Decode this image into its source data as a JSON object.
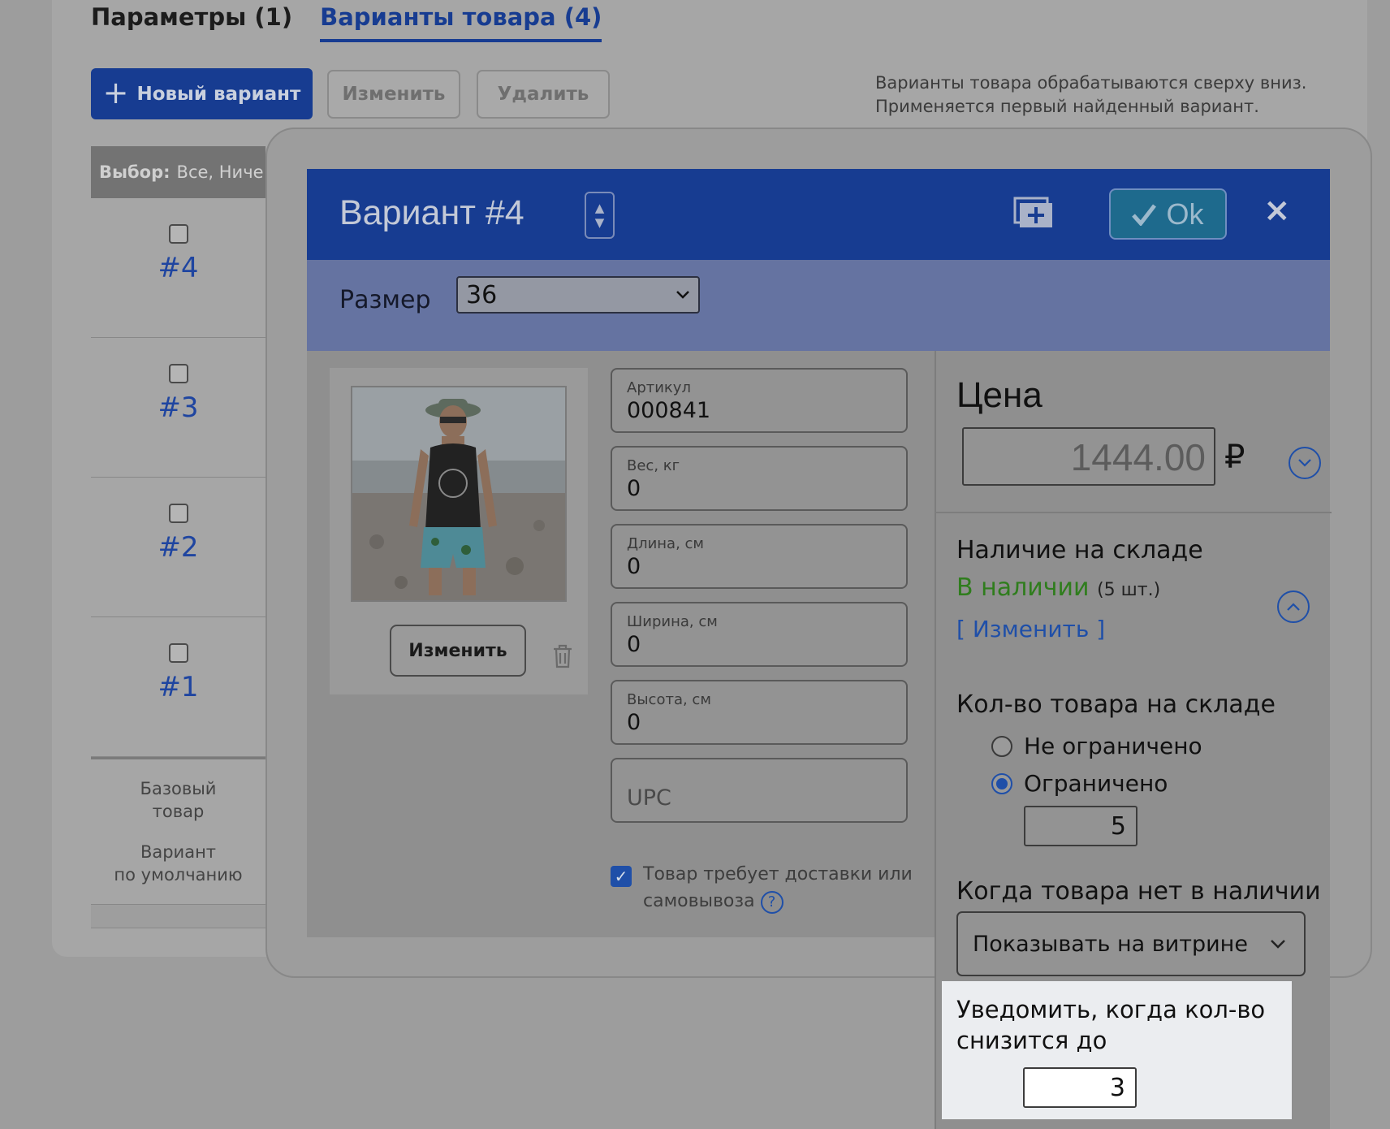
{
  "tabs": [
    {
      "label": "Параметры (1)",
      "active": false
    },
    {
      "label": "Варианты товара (4)",
      "active": true
    }
  ],
  "toolbar": {
    "new_label": "Новый вариант",
    "edit_label": "Изменить",
    "delete_label": "Удалить",
    "hint_line1": "Варианты товара обрабатываются сверху вниз.",
    "hint_line2": "Применяется первый найденный вариант."
  },
  "list": {
    "select_label": "Выбор:",
    "select_options": "Все, Ниче",
    "rows": [
      "#4",
      "#3",
      "#2",
      "#1"
    ],
    "footer_base": [
      "Базовый",
      "товар"
    ],
    "footer_default": [
      "Вариант",
      "по умолчанию"
    ]
  },
  "modal": {
    "title": "Вариант #4",
    "ok_label": "Ok",
    "close_label": "×",
    "size_label": "Размер",
    "size_value": "36",
    "image_change_label": "Изменить",
    "fields": [
      {
        "label": "Артикул",
        "value": "000841"
      },
      {
        "label": "Вес, кг",
        "value": "0"
      },
      {
        "label": "Длина, см",
        "value": "0"
      },
      {
        "label": "Ширина, см",
        "value": "0"
      },
      {
        "label": "Высота, см",
        "value": "0"
      }
    ],
    "upc_placeholder": "UPC",
    "shipping_line1": "Товар требует доставки или",
    "shipping_line2": "самовывоза",
    "shipping_checked": true
  },
  "price": {
    "title": "Цена",
    "value": "1444.00",
    "currency": "₽"
  },
  "stock": {
    "title": "Наличие на складе",
    "status": "В наличии",
    "count": "(5 шт.)",
    "change_link": "[ Изменить ]",
    "qty_title": "Кол-во товара на складе",
    "unlimited_label": "Не ограничено",
    "limited_label": "Ограничено",
    "selected": "limited",
    "qty_value": "5",
    "oos_title": "Когда товара нет в наличии",
    "oos_value": "Показывать на витрине",
    "notify_title": "Уведомить, когда кол-во снизится до",
    "notify_value": "3"
  },
  "colors": {
    "accent": "#173c91",
    "in_stock": "#2f7d1d",
    "link": "#1f4fa8"
  }
}
